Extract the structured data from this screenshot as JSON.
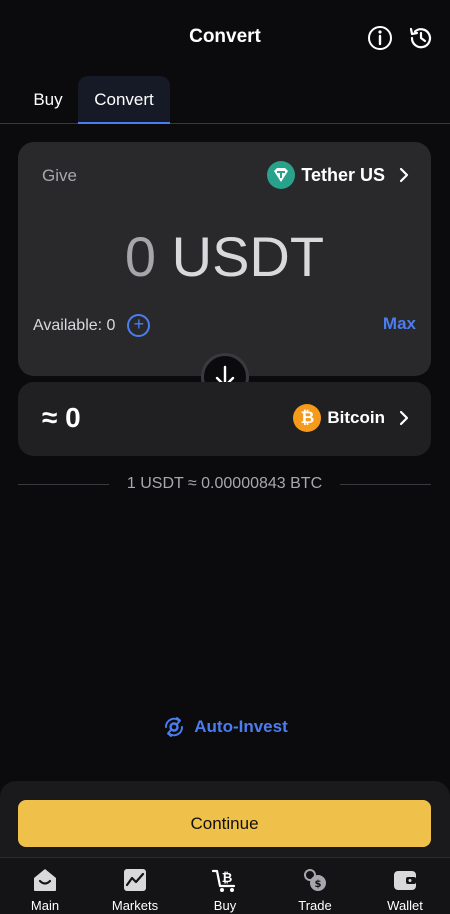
{
  "header": {
    "title": "Convert"
  },
  "tabs": [
    {
      "label": "Buy"
    },
    {
      "label": "Convert"
    }
  ],
  "give": {
    "label": "Give",
    "asset": "Tether US",
    "amount": "0",
    "unit": "USDT",
    "available_label": "Available: 0",
    "max_label": "Max"
  },
  "get": {
    "amount": "≈ 0",
    "asset": "Bitcoin"
  },
  "rate": "1 USDT ≈ 0.00000843 BTC",
  "auto_invest": "Auto-Invest",
  "continue_label": "Continue",
  "nav": [
    {
      "label": "Main"
    },
    {
      "label": "Markets"
    },
    {
      "label": "Buy"
    },
    {
      "label": "Trade"
    },
    {
      "label": "Wallet"
    }
  ],
  "colors": {
    "accent": "#4a7df0",
    "primary_button": "#efc04a",
    "tether": "#28a28a",
    "bitcoin": "#f59a1a"
  },
  "icons": [
    "info-icon",
    "history-icon",
    "tether-icon",
    "chevron-right-icon",
    "plus-icon",
    "arrow-down-icon",
    "bitcoin-icon",
    "auto-invest-icon",
    "home-icon",
    "chart-icon",
    "cart-icon",
    "trade-icon",
    "wallet-icon"
  ]
}
